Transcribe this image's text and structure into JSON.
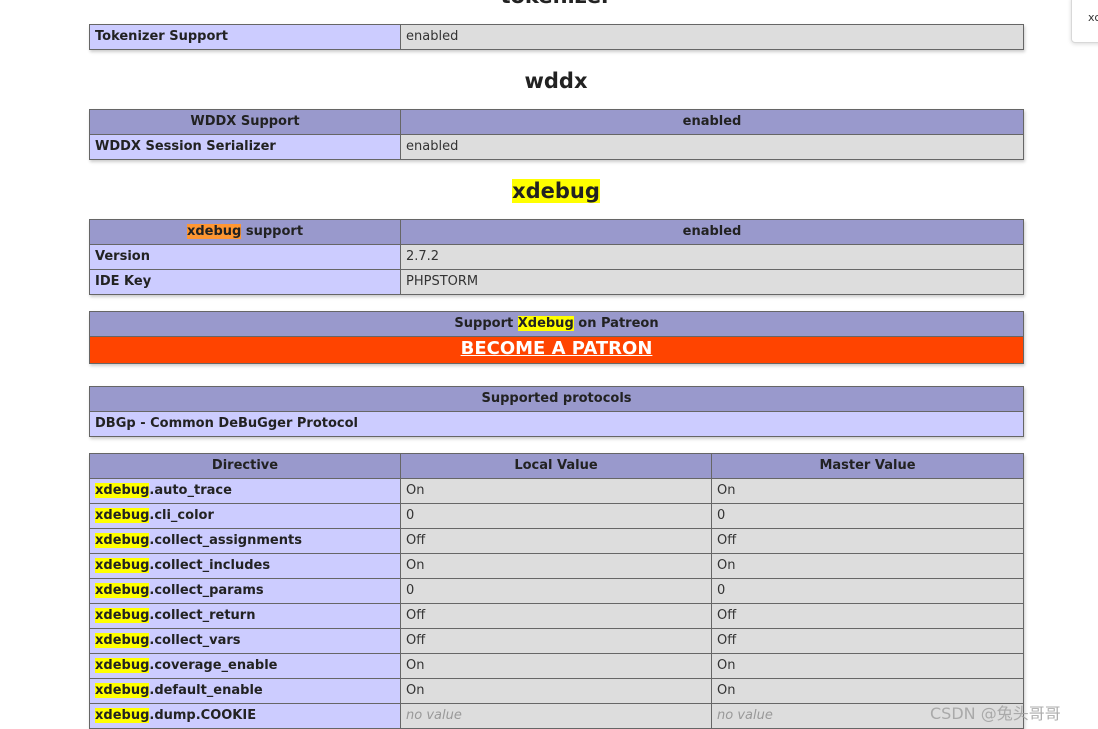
{
  "tokenizer": {
    "heading": "tokenizer",
    "row_label": "Tokenizer Support",
    "row_value": "enabled"
  },
  "wddx": {
    "heading": "wddx",
    "header_label": "WDDX Support",
    "header_value": "enabled",
    "row_label": "WDDX Session Serializer",
    "row_value": "enabled"
  },
  "xdebug": {
    "heading": "xdebug",
    "support_highlight": "xdebug",
    "support_rest": " support",
    "support_value": "enabled",
    "version_label": "Version",
    "version_value": "2.7.2",
    "idekey_label": "IDE Key",
    "idekey_value": "PHPSTORM"
  },
  "patreon": {
    "prefix": "Support ",
    "highlight": "Xdebug",
    "suffix": " on Patreon",
    "link_label": "BECOME A PATRON"
  },
  "protocols": {
    "header": "Supported protocols",
    "item": "DBGp - Common DeBuGger Protocol"
  },
  "directives": {
    "headers": [
      "Directive",
      "Local Value",
      "Master Value"
    ],
    "prefix": "xdebug",
    "rows": [
      {
        "name": ".auto_trace",
        "local": "On",
        "master": "On"
      },
      {
        "name": ".cli_color",
        "local": "0",
        "master": "0"
      },
      {
        "name": ".collect_assignments",
        "local": "Off",
        "master": "Off"
      },
      {
        "name": ".collect_includes",
        "local": "On",
        "master": "On"
      },
      {
        "name": ".collect_params",
        "local": "0",
        "master": "0"
      },
      {
        "name": ".collect_return",
        "local": "Off",
        "master": "Off"
      },
      {
        "name": ".collect_vars",
        "local": "Off",
        "master": "Off"
      },
      {
        "name": ".coverage_enable",
        "local": "On",
        "master": "On"
      },
      {
        "name": ".default_enable",
        "local": "On",
        "master": "On"
      },
      {
        "name": ".dump.COOKIE",
        "local": "no value",
        "master": "no value"
      }
    ]
  },
  "find_bar": {
    "text": "xc"
  },
  "watermark": "CSDN @兔头哥哥"
}
